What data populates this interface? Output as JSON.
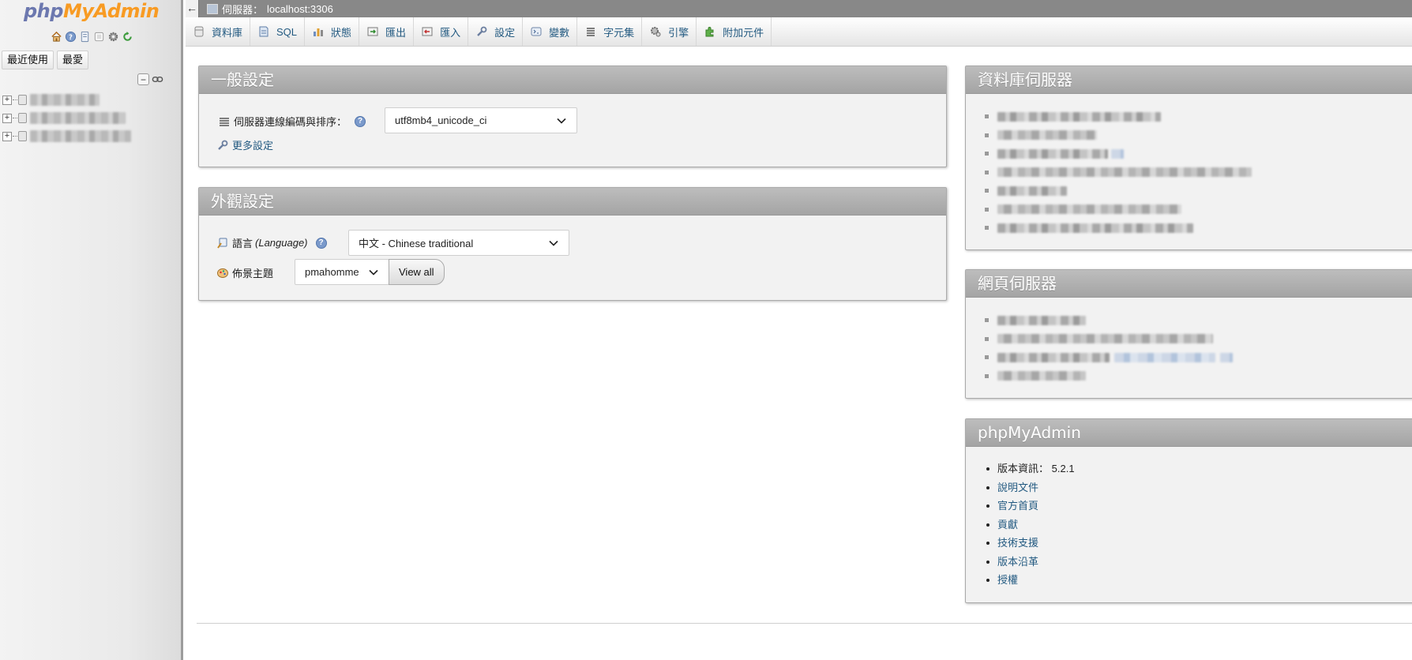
{
  "nav": {
    "logo_php": "php",
    "logo_rest": "MyAdmin",
    "tabs": [
      "最近使用",
      "最愛"
    ],
    "icons": [
      "home-icon",
      "help-icon",
      "docs-icon",
      "settings-icon",
      "reload-icon"
    ]
  },
  "topbar": {
    "back": "←",
    "server_label": "伺服器：",
    "server_value": "localhost:3306"
  },
  "menu": [
    {
      "label": "資料庫",
      "icon": "database-icon"
    },
    {
      "label": "SQL",
      "icon": "sql-icon"
    },
    {
      "label": "狀態",
      "icon": "status-icon"
    },
    {
      "label": "匯出",
      "icon": "export-icon"
    },
    {
      "label": "匯入",
      "icon": "import-icon"
    },
    {
      "label": "設定",
      "icon": "wrench-icon"
    },
    {
      "label": "變數",
      "icon": "variables-icon"
    },
    {
      "label": "字元集",
      "icon": "charset-icon"
    },
    {
      "label": "引擎",
      "icon": "engine-icon"
    },
    {
      "label": "附加元件",
      "icon": "plugin-icon"
    }
  ],
  "general": {
    "title": "一般設定",
    "collation_label": "伺服器連線編碼與排序：",
    "collation_value": "utf8mb4_unicode_ci",
    "more_settings": "更多設定"
  },
  "appearance": {
    "title": "外觀設定",
    "language_label": "語言",
    "language_label_en": "(Language)",
    "language_value": "中文 - Chinese traditional",
    "theme_label": "佈景主題",
    "theme_value": "pmahomme",
    "view_all": "View all"
  },
  "dbserver": {
    "title": "資料庫伺服器"
  },
  "webserver": {
    "title": "網頁伺服器"
  },
  "pma": {
    "title": "phpMyAdmin",
    "version_label": "版本資訊：",
    "version_value": "5.2.1",
    "links": [
      "說明文件",
      "官方首頁",
      "貢獻",
      "技術支援",
      "版本沿革",
      "授權"
    ]
  },
  "colors": {
    "link": "#235a81",
    "header_gray": "#a4a4a4",
    "topbar": "#888888",
    "logo_blue": "#6c78af",
    "logo_orange": "#f89b23"
  }
}
